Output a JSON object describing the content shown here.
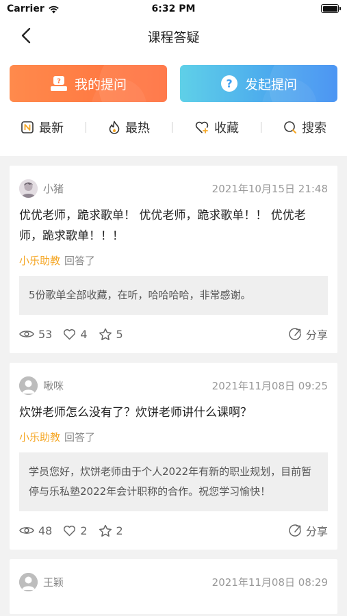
{
  "status_bar": {
    "carrier": "Carrier",
    "time": "6:32 PM"
  },
  "nav": {
    "title": "课程答疑"
  },
  "actions": {
    "my_questions": "我的提问",
    "ask_question": "发起提问"
  },
  "filters": {
    "latest": "最新",
    "hottest": "最热",
    "favorites": "收藏",
    "search": "搜索"
  },
  "colors": {
    "accent_orange": "#ff7a45",
    "accent_blue": "#3d8df2",
    "assistant": "#f5a623"
  },
  "posts": [
    {
      "user": "小猪",
      "time": "2021年10月15日 21:48",
      "question": "优优老师，跪求歌单！ 优优老师，跪求歌单！！ 优优老师，跪求歌单！！！",
      "answerer": "小乐助教",
      "answered_label": "回答了",
      "answer": "5份歌单全部收藏，在听，哈哈哈哈，非常感谢。",
      "views": "53",
      "likes": "4",
      "stars": "5",
      "share": "分享"
    },
    {
      "user": "啾咪",
      "time": "2021年11月08日 09:25",
      "question": "炊饼老师怎么没有了？炊饼老师讲什么课啊？",
      "answerer": "小乐助教",
      "answered_label": "回答了",
      "answer": "学员您好，炊饼老师由于个人2022年有新的职业规划，目前暂停与乐私塾2022年会计职称的合作。祝您学习愉快！",
      "views": "48",
      "likes": "2",
      "stars": "2",
      "share": "分享"
    },
    {
      "user": "王颖",
      "time": "2021年11月08日 08:29"
    }
  ]
}
